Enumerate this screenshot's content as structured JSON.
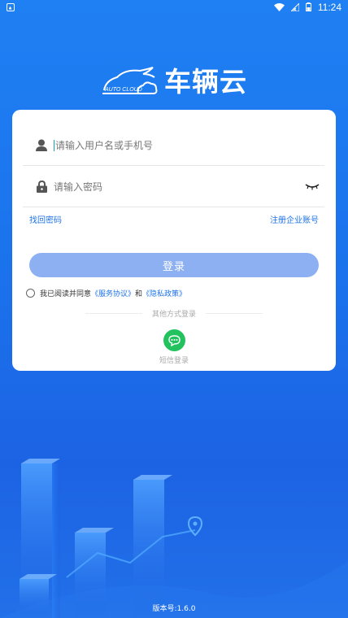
{
  "status_bar": {
    "time": "11:24"
  },
  "logo": {
    "badge_text": "AUTO CLOUD",
    "app_name": "车辆云"
  },
  "login": {
    "username_placeholder": "请输入用户名或手机号",
    "password_placeholder": "请输入密码",
    "forgot_password": "找回密码",
    "register": "注册企业账号",
    "login_button": "登录",
    "agreement_prefix": "我已阅读并同意",
    "service_agreement": "《服务协议》",
    "and": "和",
    "privacy_policy": "《隐私政策》",
    "other_methods": "其他方式登录",
    "sms_login": "短信登录"
  },
  "version": "版本号:1.6.0",
  "colors": {
    "primary": "#1f73e8",
    "button": "#8db0f2",
    "sms": "#22c25e"
  }
}
